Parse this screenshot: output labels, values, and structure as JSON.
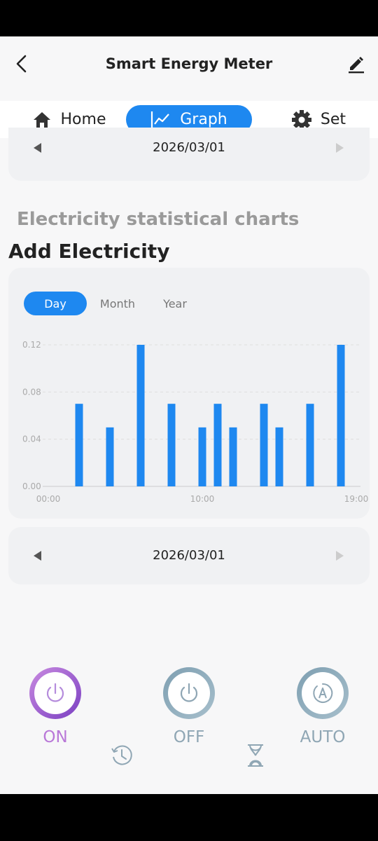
{
  "header": {
    "title": "Smart Energy Meter"
  },
  "tabs": [
    {
      "label": "Home",
      "icon": "home-icon",
      "active": false
    },
    {
      "label": "Graph",
      "icon": "graph-icon",
      "active": true
    },
    {
      "label": "Set",
      "icon": "gear-icon",
      "active": false
    }
  ],
  "top_date": "2026/03/01",
  "section": {
    "title": "Electricity statistical charts",
    "subtitle": "Add Electricity"
  },
  "period_tabs": [
    {
      "label": "Day",
      "active": true
    },
    {
      "label": "Month",
      "active": false
    },
    {
      "label": "Year",
      "active": false
    }
  ],
  "bottom_date": "2026/03/01",
  "controls": [
    {
      "label": "ON",
      "icon": "power-icon"
    },
    {
      "label": "OFF",
      "icon": "power-icon"
    },
    {
      "label": "AUTO",
      "icon": "auto-icon"
    }
  ],
  "accent_color": "#1e88f0",
  "chart_data": {
    "type": "bar",
    "x": [
      0,
      1,
      2,
      3,
      4,
      5,
      6,
      7,
      8,
      9,
      10,
      11,
      12,
      13,
      14,
      15,
      16,
      17,
      18,
      19,
      20
    ],
    "values": [
      0,
      0,
      0.07,
      0,
      0.05,
      0,
      0.12,
      0,
      0.07,
      0,
      0.05,
      0.07,
      0.05,
      0,
      0.07,
      0.05,
      0,
      0.07,
      0,
      0.12,
      0
    ],
    "x_tick_labels": [
      "00:00",
      "10:00",
      "19:00"
    ],
    "x_tick_positions": [
      0,
      10,
      20
    ],
    "y_ticks": [
      0.0,
      0.04,
      0.08,
      0.12
    ],
    "ylim": [
      0,
      0.12
    ],
    "grid": true,
    "color": "#1e88f0"
  }
}
